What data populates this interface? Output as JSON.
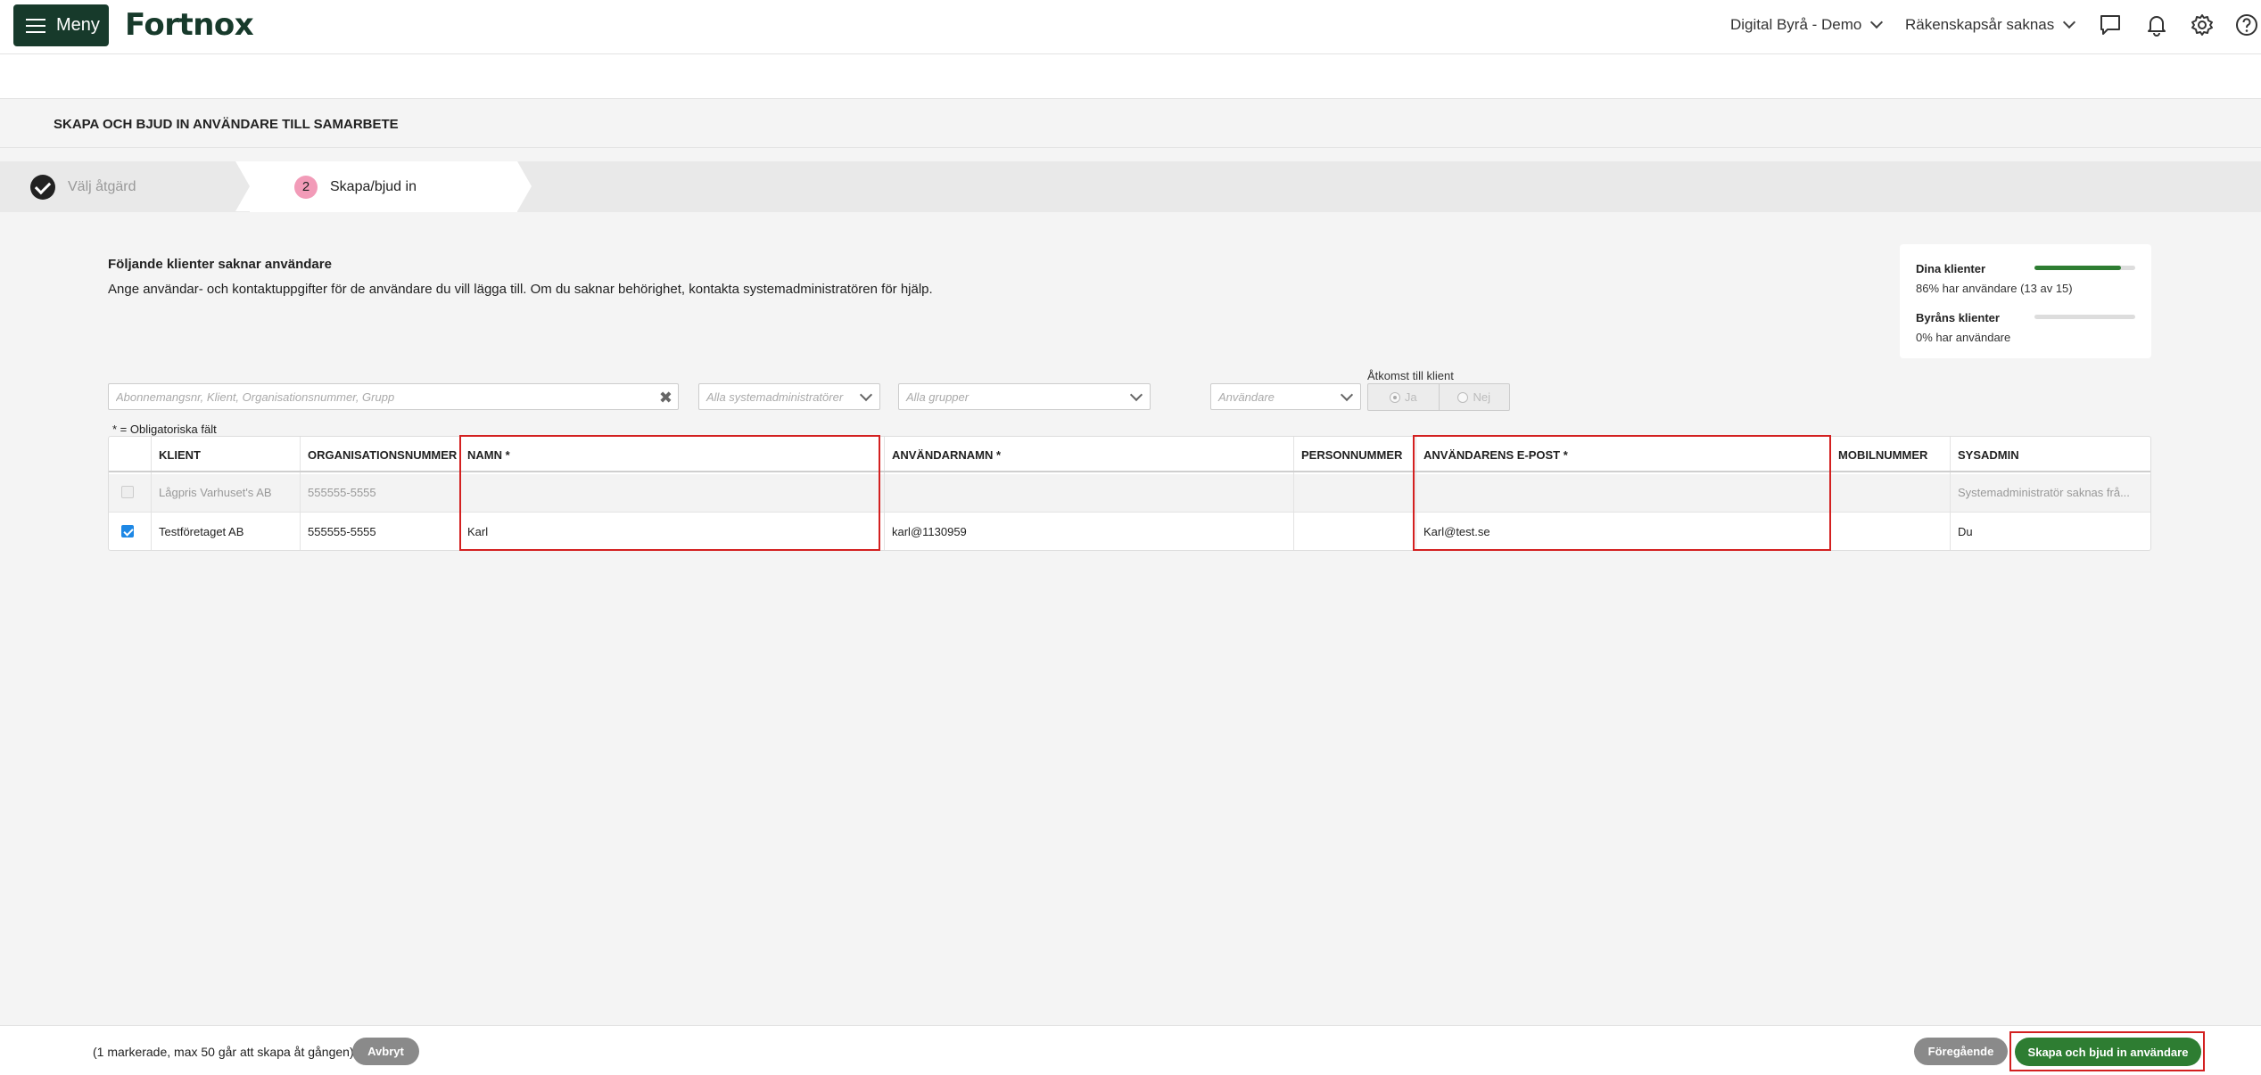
{
  "topbar": {
    "menu_label": "Meny",
    "logo": "Fortnox",
    "company": "Digital Byrå - Demo",
    "fiscal_year": "Räkenskapsår saknas",
    "icons": [
      "chat-icon",
      "bell-icon",
      "gear-icon",
      "help-icon"
    ]
  },
  "page": {
    "title": "SKAPA OCH BJUD IN ANVÄNDARE TILL SAMARBETE"
  },
  "steps": [
    {
      "label": "Välj åtgärd",
      "state": "done"
    },
    {
      "number": "2",
      "label": "Skapa/bjud in",
      "state": "active"
    }
  ],
  "intro": {
    "title": "Följande klienter saknar användare",
    "text": "Ange användar- och kontaktuppgifter för de användare du vill lägga till. Om du saknar behörighet, kontakta systemadministratören för hjälp."
  },
  "stats": {
    "dina_label": "Dina klienter",
    "dina_sub": "86% har användare (13 av 15)",
    "dina_progress": 0.86,
    "byran_label": "Byråns klienter",
    "byran_sub": "0% har användare",
    "byran_progress": 0.0,
    "bar_color": "#2e7d32"
  },
  "filters": {
    "search_placeholder": "Abonnemangsnr, Klient, Organisationsnummer, Grupp",
    "sysadmin_placeholder": "Alla systemadministratörer",
    "groups_placeholder": "Alla grupper",
    "users_placeholder": "Användare",
    "access_label": "Åtkomst till klient",
    "access_yes": "Ja",
    "access_no": "Nej"
  },
  "mandatory_note": "* = Obligatoriska fält",
  "table": {
    "headers": [
      "KLIENT",
      "ORGANISATIONSNUMMER",
      "NAMN *",
      "ANVÄNDARNAMN *",
      "PERSONNUMMER",
      "ANVÄNDARENS E-POST *",
      "MOBILNUMMER",
      "SYSADMIN"
    ],
    "rows": [
      {
        "checked": false,
        "disabled": true,
        "klient": "Lågpris Varhuset's AB",
        "orgnr": "555555-5555",
        "namn": "",
        "anvandarnamn": "",
        "personnummer": "",
        "epost": "",
        "mobil": "",
        "sysadmin": "Systemadministratör saknas frå..."
      },
      {
        "checked": true,
        "disabled": false,
        "klient": "Testföretaget AB",
        "orgnr": "555555-5555",
        "namn": "Karl",
        "anvandarnamn": "karl@1130959",
        "personnummer": "",
        "epost": "Karl@test.se",
        "mobil": "",
        "sysadmin": "Du"
      }
    ]
  },
  "footer": {
    "info": "(1 markerade, max 50 går att skapa åt gången)",
    "cancel": "Avbryt",
    "previous": "Föregående",
    "submit": "Skapa och bjud in användare"
  },
  "colors": {
    "brand_dark": "#173a2b",
    "primary_green": "#2e7d32",
    "step_badge": "#f29bb8",
    "highlight_red": "#d32020"
  }
}
